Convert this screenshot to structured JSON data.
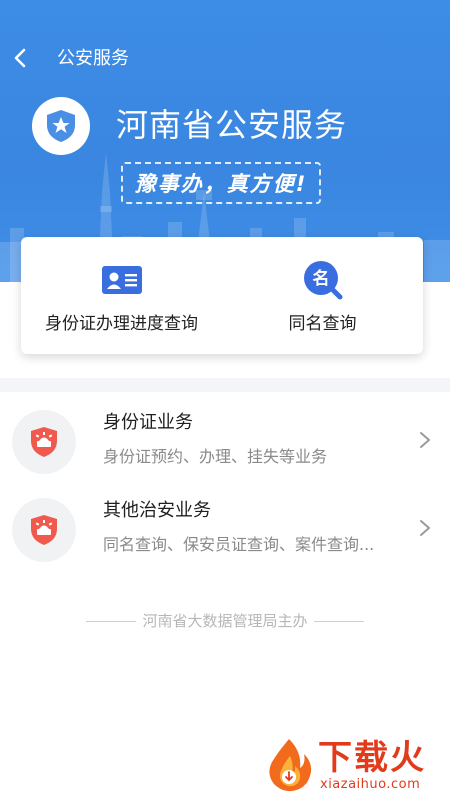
{
  "nav": {
    "title": "公安服务"
  },
  "header": {
    "title": "河南省公安服务",
    "slogan": "豫事办，真方便!"
  },
  "quick_actions": [
    {
      "label": "身份证办理进度查询",
      "icon": "id-card-icon"
    },
    {
      "label": "同名查询",
      "icon": "same-name-search-icon",
      "icon_text": "名"
    }
  ],
  "services": [
    {
      "title": "身份证业务",
      "subtitle": "身份证预约、办理、挂失等业务",
      "icon": "police-shield-icon"
    },
    {
      "title": "其他治安业务",
      "subtitle": "同名查询、保安员证查询、案件查询...",
      "icon": "police-shield-icon"
    }
  ],
  "footer": {
    "note": "河南省大数据管理局主办"
  },
  "watermark": {
    "brand": "下载火",
    "domain": "xiazaihuo.com"
  },
  "colors": {
    "primary": "#3a86e0",
    "accent_red": "#f05a4e",
    "watermark": "#e13b1c"
  }
}
